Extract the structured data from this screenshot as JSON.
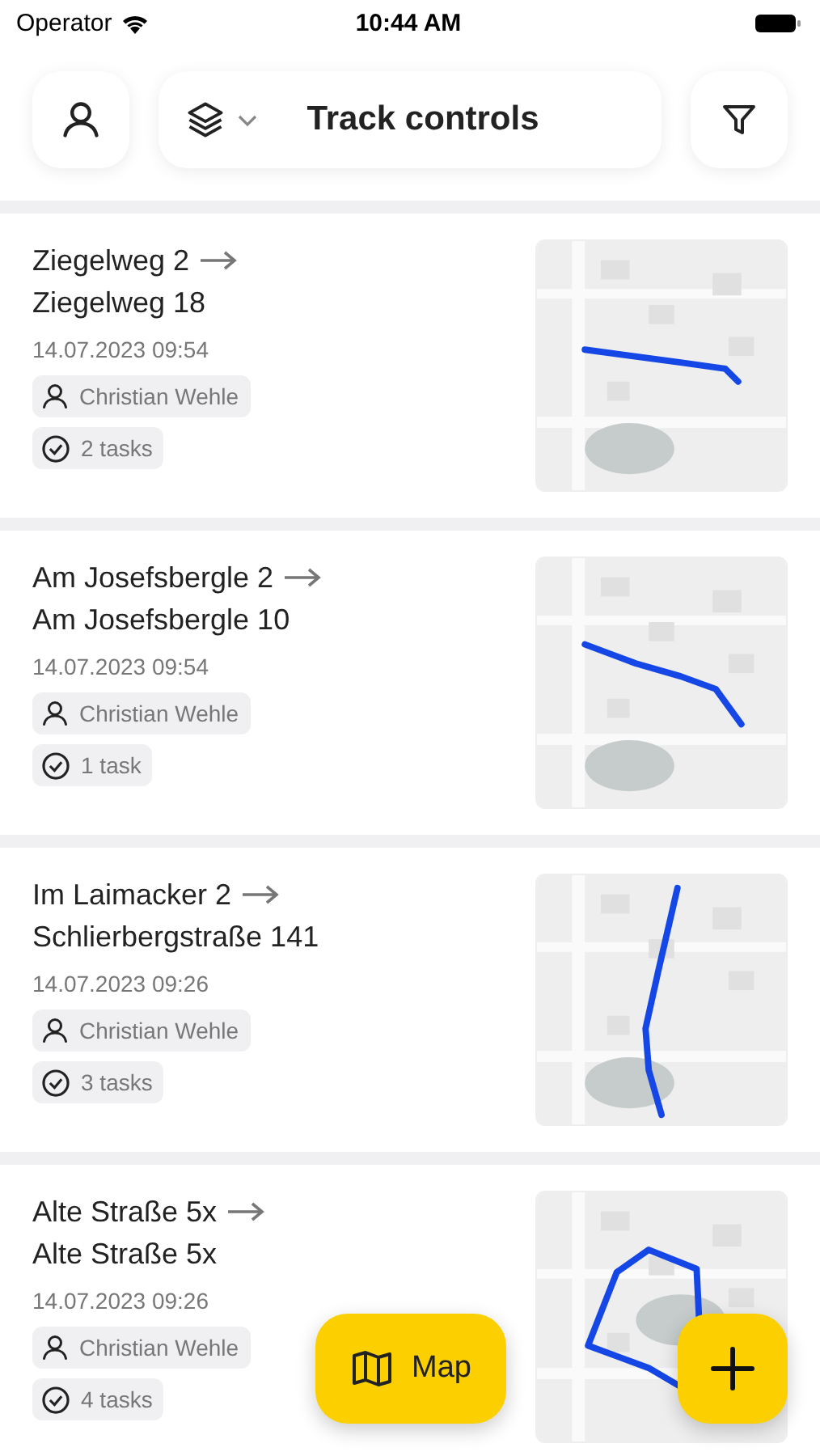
{
  "status_bar": {
    "carrier": "Operator",
    "time": "10:44 AM"
  },
  "header": {
    "title": "Track controls"
  },
  "tracks": [
    {
      "from": "Ziegelweg 2",
      "to": "Ziegelweg 18",
      "date": "14.07.2023 09:54",
      "person": "Christian Wehle",
      "tasks": "2 tasks"
    },
    {
      "from": "Am Josefsbergle 2",
      "to": "Am Josefsbergle 10",
      "date": "14.07.2023 09:54",
      "person": "Christian Wehle",
      "tasks": "1 task"
    },
    {
      "from": "Im Laimacker 2",
      "to": "Schlierbergstraße 141",
      "date": "14.07.2023 09:26",
      "person": "Christian Wehle",
      "tasks": "3 tasks"
    },
    {
      "from": "Alte Straße 5x",
      "to": "Alte Straße 5x",
      "date": "14.07.2023 09:26",
      "person": "Christian Wehle",
      "tasks": "4 tasks"
    }
  ],
  "map_button": {
    "label": "Map"
  }
}
